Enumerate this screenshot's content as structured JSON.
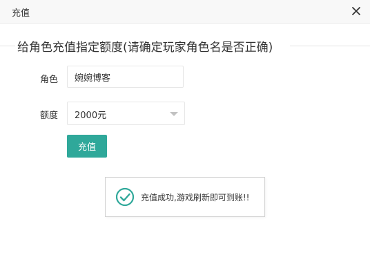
{
  "dialog": {
    "title": "充值",
    "close_icon": "close-icon"
  },
  "form": {
    "legend": "给角色充值指定额度(请确定玩家角色名是否正确)",
    "role": {
      "label": "角色",
      "value": "婉婉博客"
    },
    "amount": {
      "label": "额度",
      "selected": "2000元",
      "arrow_icon": "caret-down-icon"
    },
    "submit_label": "充值"
  },
  "toast": {
    "icon": "check-circle-icon",
    "message": "充值成功,游戏刷新即可到账!!"
  },
  "colors": {
    "accent": "#2fa89a",
    "success": "#2fa89a",
    "border": "#e6e6e6"
  }
}
